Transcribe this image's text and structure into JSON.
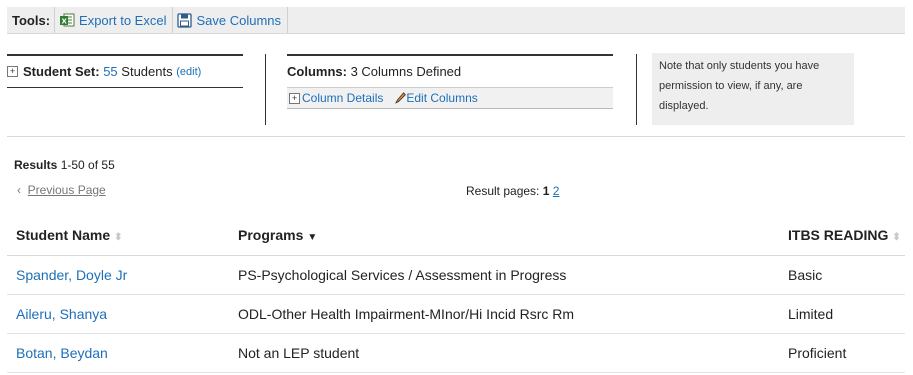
{
  "toolbar": {
    "label": "Tools:",
    "export_label": "Export to Excel",
    "save_label": "Save Columns",
    "export_icon": "excel-icon",
    "save_icon": "floppy-disk-icon"
  },
  "student_set": {
    "label": "Student Set:",
    "count_text": "55",
    "students_text": "Students",
    "edit_label": "(edit)"
  },
  "columns": {
    "label": "Columns:",
    "value": "3 Columns Defined",
    "details_label": "Column Details",
    "edit_label": "Edit Columns"
  },
  "note": {
    "line1": "Note that only students you have",
    "line2": "permission to view, if any, are",
    "line3": "displayed."
  },
  "results": {
    "label": "Results",
    "range": "1-50 of 55"
  },
  "pagination": {
    "prev_arrow": "‹",
    "prev_label": "Previous Page",
    "pages_label": "Result pages:",
    "current": "1",
    "next": "2"
  },
  "table": {
    "headers": [
      "Student Name",
      "Programs",
      "ITBS READING"
    ],
    "rows": [
      {
        "name": "Spander, Doyle Jr",
        "program": "PS-Psychological Services / Assessment in Progress",
        "reading": "Basic"
      },
      {
        "name": "Aileru, Shanya",
        "program": "ODL-Other Health Impairment-MInor/Hi Incid Rsrc Rm",
        "reading": "Limited"
      },
      {
        "name": "Botan, Beydan",
        "program": "Not an LEP student",
        "reading": "Proficient"
      }
    ]
  },
  "colors": {
    "link": "#1e6fb8",
    "toolbar_bg": "#eeeeee",
    "note_bg": "#eeeeee"
  }
}
